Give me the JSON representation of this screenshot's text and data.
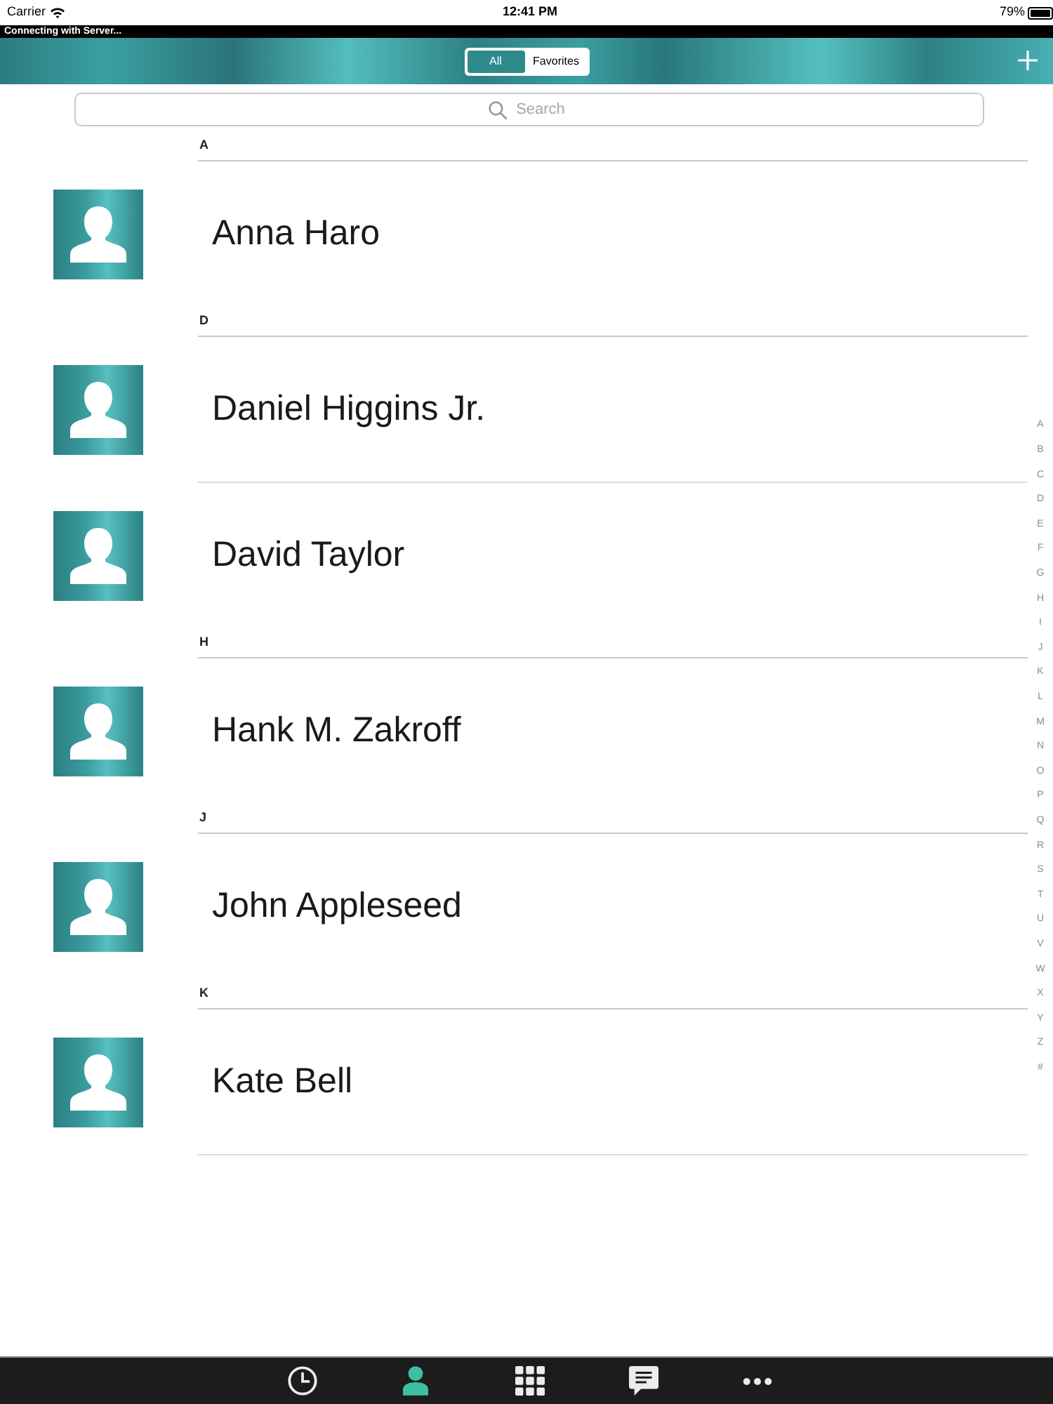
{
  "status_bar": {
    "carrier": "Carrier",
    "time": "12:41 PM",
    "battery": "79%"
  },
  "connection_banner": "Connecting with Server...",
  "header": {
    "segments": [
      {
        "label": "All",
        "selected": true
      },
      {
        "label": "Favorites",
        "selected": false
      }
    ]
  },
  "search": {
    "placeholder": "Search"
  },
  "sections": [
    {
      "letter": "A",
      "contacts": [
        "Anna Haro"
      ]
    },
    {
      "letter": "D",
      "contacts": [
        "Daniel Higgins Jr.",
        "David Taylor"
      ]
    },
    {
      "letter": "H",
      "contacts": [
        "Hank M. Zakroff"
      ]
    },
    {
      "letter": "J",
      "contacts": [
        "John Appleseed"
      ]
    },
    {
      "letter": "K",
      "contacts": [
        "Kate Bell"
      ]
    }
  ],
  "index_letters": [
    "A",
    "B",
    "C",
    "D",
    "E",
    "F",
    "G",
    "H",
    "I",
    "J",
    "K",
    "L",
    "M",
    "N",
    "O",
    "P",
    "Q",
    "R",
    "S",
    "T",
    "U",
    "V",
    "W",
    "X",
    "Y",
    "Z",
    "#"
  ],
  "tab_bar": [
    {
      "kind": "recents",
      "selected": false
    },
    {
      "kind": "contacts",
      "selected": true
    },
    {
      "kind": "keypad",
      "selected": false
    },
    {
      "kind": "messages",
      "selected": false
    },
    {
      "kind": "more",
      "selected": false
    }
  ]
}
